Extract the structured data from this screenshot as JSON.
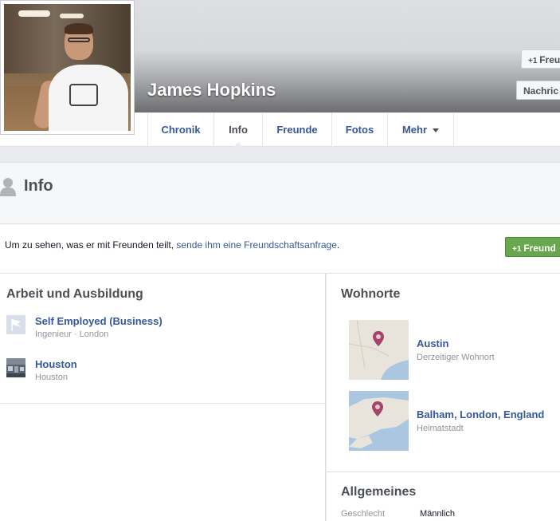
{
  "profile": {
    "name": "James Hopkins",
    "buttons": {
      "add_friend": "Freu",
      "message": "Nachric"
    }
  },
  "tabs": [
    {
      "label": "Chronik"
    },
    {
      "label": "Info"
    },
    {
      "label": "Freunde"
    },
    {
      "label": "Fotos"
    },
    {
      "label": "Mehr"
    }
  ],
  "info_header": {
    "title": "Info"
  },
  "notice": {
    "text_before": "Um zu sehen, was er mit Freunden teilt, ",
    "link": "sende ihm eine Freundschaftsanfrage",
    "text_after": ".",
    "button": "Freund"
  },
  "work": {
    "title": "Arbeit und Ausbildung",
    "items": [
      {
        "name": "Self Employed (Business)",
        "sub": "Ingenieur · London"
      },
      {
        "name": "Houston",
        "sub": "Houston"
      }
    ]
  },
  "places": {
    "title": "Wohnorte",
    "items": [
      {
        "name": "Austin",
        "sub": "Derzeitiger Wohnort"
      },
      {
        "name": "Balham, London, England",
        "sub": "Heimatstadt"
      }
    ]
  },
  "general": {
    "title": "Allgemeines",
    "rows": [
      {
        "label": "Geschlecht",
        "value": "Männlich"
      }
    ]
  },
  "colors": {
    "link": "#365899",
    "friend_button": "#69a74e",
    "background": "#e9ebee"
  }
}
